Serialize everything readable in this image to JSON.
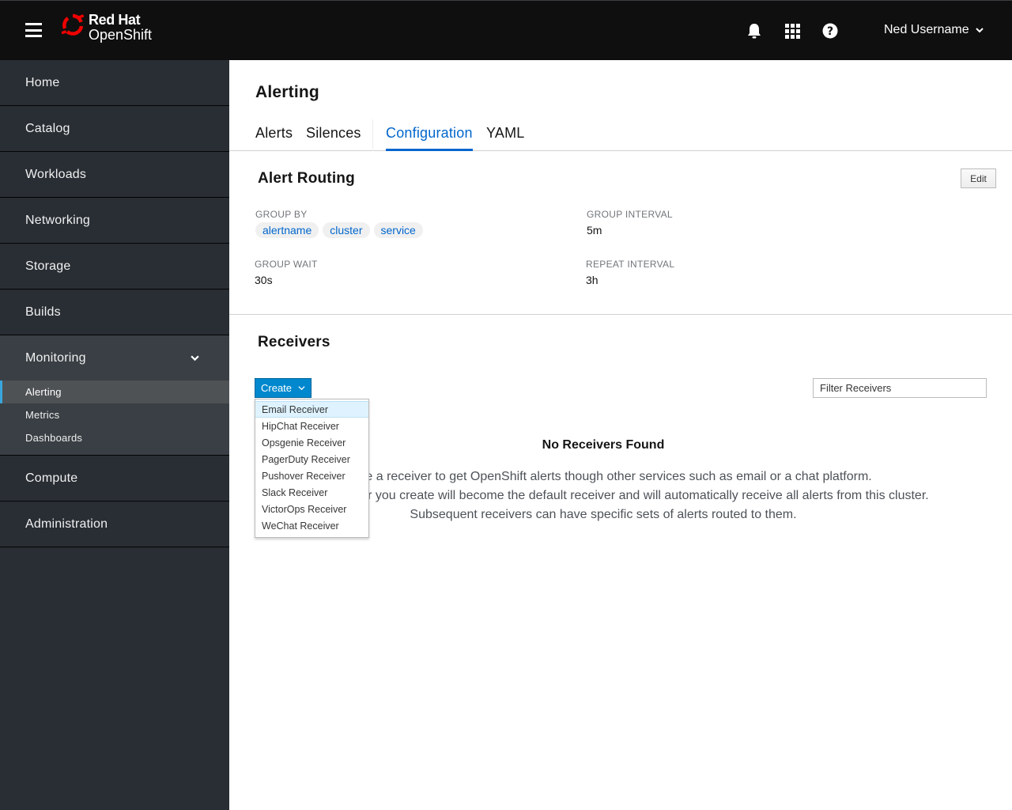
{
  "masthead": {
    "brand_line1": "Red Hat",
    "brand_line2": "OpenShift",
    "icons": [
      "bell-icon",
      "app-launcher-grid-icon",
      "help-icon"
    ],
    "user_name": "Ned Username"
  },
  "sidebar": {
    "items": [
      {
        "label": "Home"
      },
      {
        "label": "Catalog"
      },
      {
        "label": "Workloads"
      },
      {
        "label": "Networking"
      },
      {
        "label": "Storage"
      },
      {
        "label": "Builds"
      },
      {
        "label": "Monitoring",
        "expanded": true,
        "children": [
          {
            "label": "Alerting",
            "active": true
          },
          {
            "label": "Metrics"
          },
          {
            "label": "Dashboards"
          }
        ]
      },
      {
        "label": "Compute"
      },
      {
        "label": "Administration"
      }
    ]
  },
  "page": {
    "title": "Alerting",
    "tabs": [
      {
        "label": "Alerts"
      },
      {
        "label": "Silences"
      },
      {
        "label": "Configuration",
        "active": true
      },
      {
        "label": "YAML"
      }
    ]
  },
  "alert_routing": {
    "title": "Alert Routing",
    "edit_label": "Edit",
    "group_by_label": "GROUP BY",
    "group_by": [
      "alertname",
      "cluster",
      "service"
    ],
    "group_interval_label": "GROUP INTERVAL",
    "group_interval": "5m",
    "group_wait_label": "GROUP WAIT",
    "group_wait": "30s",
    "repeat_interval_label": "REPEAT INTERVAL",
    "repeat_interval": "3h"
  },
  "receivers": {
    "title": "Receivers",
    "create_label": "Create",
    "filter_placeholder": "Filter Receivers",
    "create_menu": [
      "Email Receiver",
      "HipChat Receiver",
      "Opsgenie Receiver",
      "PagerDuty Receiver",
      "Pushover Receiver",
      "Slack Receiver",
      "VictorOps Receiver",
      "WeChat Receiver"
    ],
    "empty_title": "No Receivers Found",
    "empty_lines": [
      "Create a receiver to get OpenShift alerts though other services such as email or a chat platform.",
      "The first receiver you create will become the default receiver and will automatically receive all alerts from this cluster.",
      "Subsequent receivers can have specific sets of alerts routed to them."
    ]
  },
  "colors": {
    "masthead_bg": "#0f0f0f",
    "sidebar_bg": "#292e34",
    "accent_blue": "#0066cc",
    "primary_button": "#0088ce",
    "active_indicator": "#39a5dc",
    "brand_red": "#ee0000"
  }
}
